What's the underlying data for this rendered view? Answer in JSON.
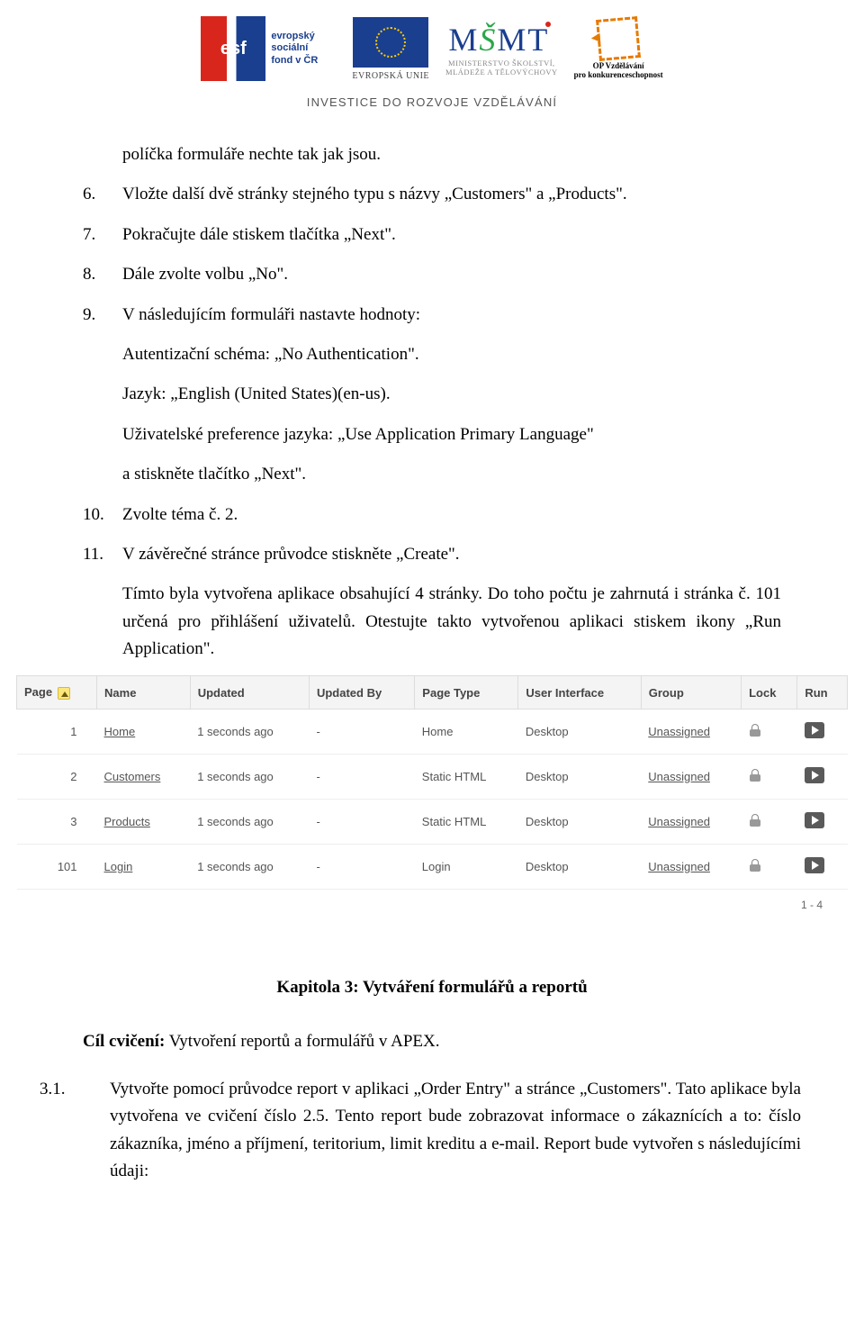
{
  "header": {
    "esf_text": "evropský\nsociální\nfond v ČR",
    "eu_caption": "EVROPSKÁ UNIE",
    "msmt_line1": "MINISTERSTVO ŠKOLSTVÍ,",
    "msmt_line2": "MLÁDEŽE A TĚLOVÝCHOVY",
    "opvk_line1": "OP Vzdělávání",
    "opvk_line2": "pro konkurenceschopnost",
    "investice": "INVESTICE DO ROZVOJE VZDĚLÁVÁNÍ"
  },
  "body": {
    "p0": "políčka formuláře nechte tak jak jsou.",
    "i6n": "6.",
    "i6t": "Vložte další dvě stránky stejného typu s názvy „Customers\" a „Products\".",
    "i7n": "7.",
    "i7t": "Pokračujte dále stiskem tlačítka „Next\".",
    "i8n": "8.",
    "i8t": "Dále zvolte volbu „No\".",
    "i9n": "9.",
    "i9t": "V následujícím formuláři nastavte hodnoty:",
    "sub_a": "Autentizační schéma: „No Authentication\".",
    "sub_b": "Jazyk: „English (United States)(en-us).",
    "sub_c": "Uživatelské preference jazyka: „Use Application Primary Language\"",
    "sub_d": "a stiskněte tlačítko „Next\".",
    "i10n": "10.",
    "i10t": "Zvolte téma č. 2.",
    "i11n": "11.",
    "i11t": "V závěrečné stránce průvodce stiskněte „Create\".",
    "sub_e": "Tímto byla vytvořena aplikace obsahující 4 stránky. Do toho počtu je zahrnutá i stránka č. 101 určená pro přihlášení uživatelů. Otestujte takto vytvořenou aplikaci stiskem ikony „Run Application\"."
  },
  "table": {
    "columns": {
      "page": "Page",
      "name": "Name",
      "updated": "Updated",
      "updated_by": "Updated By",
      "page_type": "Page Type",
      "ui": "User Interface",
      "group": "Group",
      "lock": "Lock",
      "run": "Run"
    },
    "rows": [
      {
        "page": "1",
        "name": "Home",
        "updated": "1 seconds ago",
        "updated_by": "-",
        "page_type": "Home",
        "ui": "Desktop",
        "group": "Unassigned"
      },
      {
        "page": "2",
        "name": "Customers",
        "updated": "1 seconds ago",
        "updated_by": "-",
        "page_type": "Static HTML",
        "ui": "Desktop",
        "group": "Unassigned"
      },
      {
        "page": "3",
        "name": "Products",
        "updated": "1 seconds ago",
        "updated_by": "-",
        "page_type": "Static HTML",
        "ui": "Desktop",
        "group": "Unassigned"
      },
      {
        "page": "101",
        "name": "Login",
        "updated": "1 seconds ago",
        "updated_by": "-",
        "page_type": "Login",
        "ui": "Desktop",
        "group": "Unassigned"
      }
    ],
    "footer": "1 - 4"
  },
  "chapter": {
    "title": "Kapitola 3: Vytváření formulářů a reportů",
    "cil_label": "Cíl cvičení:",
    "cil_text": " Vytvoření reportů a formulářů v APEX.",
    "n31": "3.1.",
    "n31t": "Vytvořte pomocí průvodce report v aplikaci „Order Entry\" a stránce „Customers\". Tato aplikace byla vytvořena ve cvičení číslo 2.5. Tento report bude zobrazovat informace o zákaznících a to: číslo zákazníka, jméno a příjmení, teritorium, limit kreditu a e-mail. Report bude vytvořen s následujícími údaji:"
  }
}
